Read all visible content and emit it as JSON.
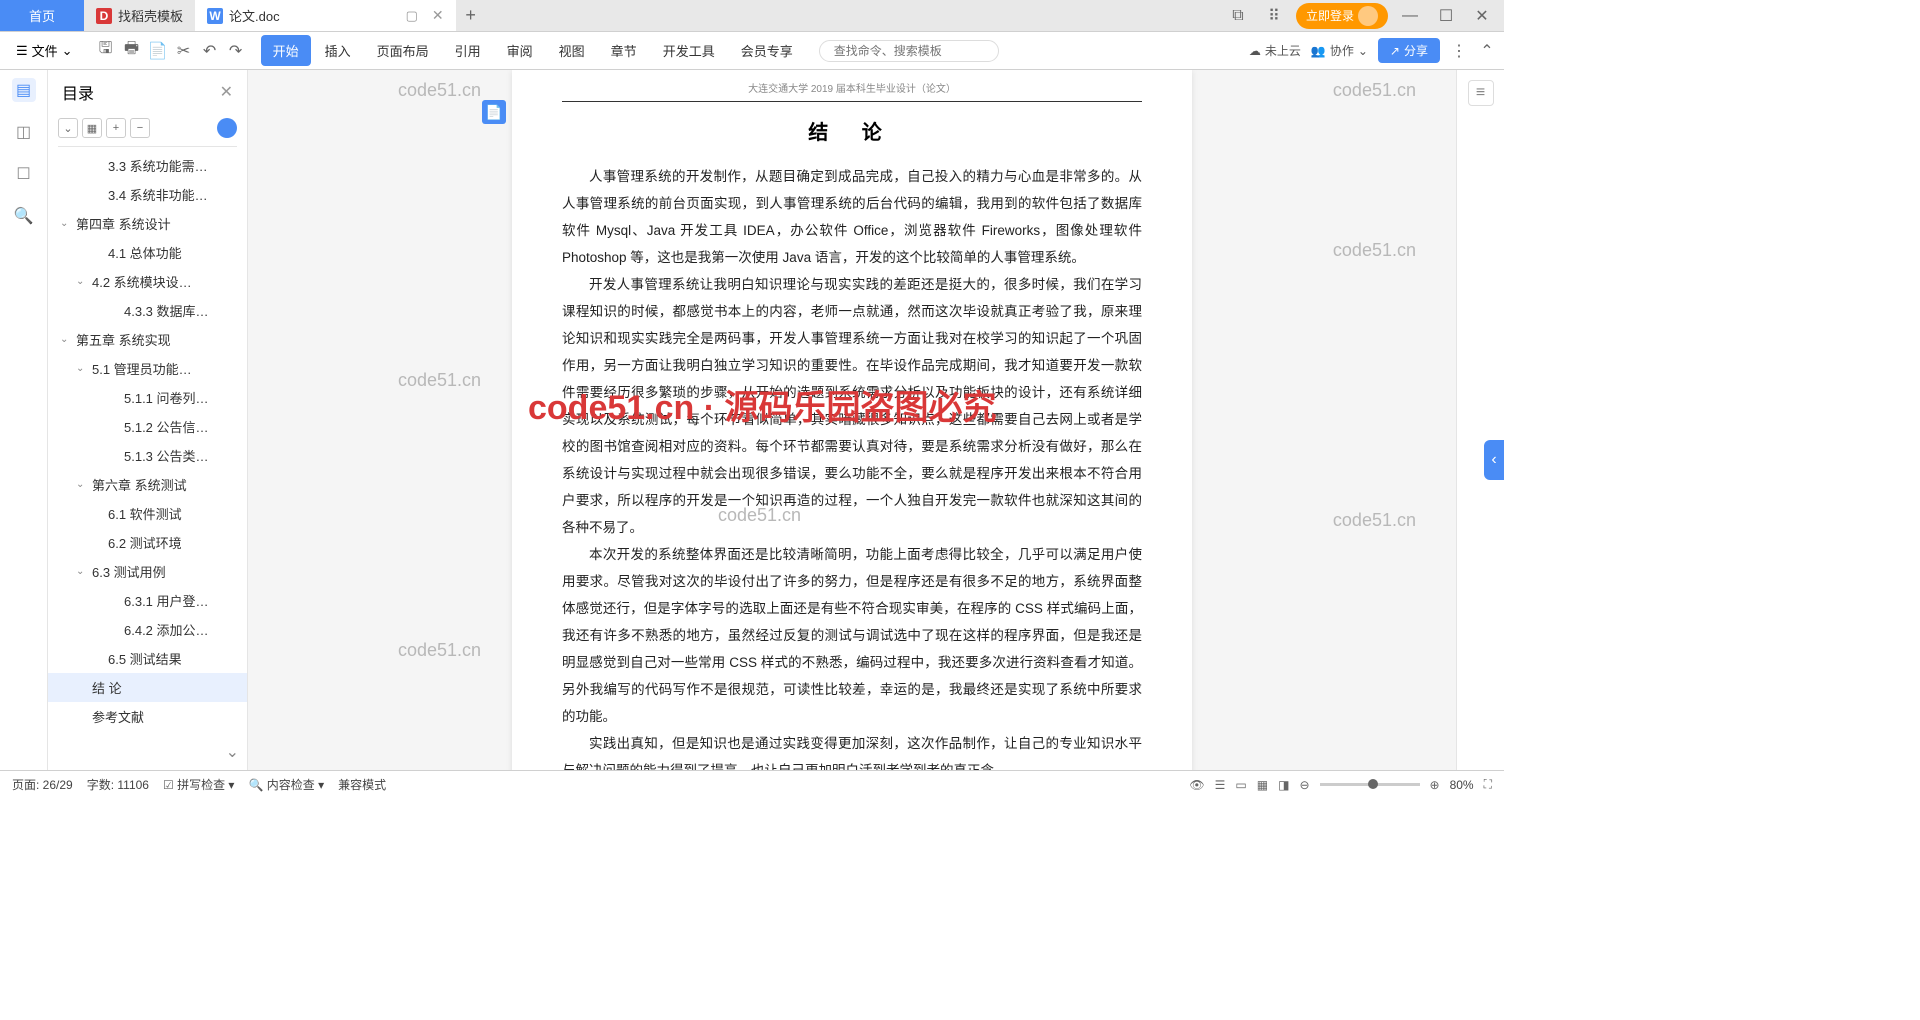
{
  "tabs": {
    "home": "首页",
    "items": [
      {
        "icon": "D",
        "label": "找稻壳模板",
        "active": false
      },
      {
        "icon": "W",
        "label": "论文.doc",
        "active": true
      }
    ],
    "login": "立即登录"
  },
  "ribbon": {
    "file_menu": "文件",
    "tabs": [
      "开始",
      "插入",
      "页面布局",
      "引用",
      "审阅",
      "视图",
      "章节",
      "开发工具",
      "会员专享"
    ],
    "active_idx": 0,
    "search_placeholder": "查找命令、搜索模板",
    "cloud": "未上云",
    "collab": "协作",
    "share": "分享"
  },
  "outline": {
    "title": "目录",
    "items": [
      {
        "indent": 2,
        "chev": "",
        "label": "3.3 系统功能需…"
      },
      {
        "indent": 2,
        "chev": "",
        "label": "3.4 系统非功能…"
      },
      {
        "indent": 0,
        "chev": "⌄",
        "label": "第四章 系统设计"
      },
      {
        "indent": 2,
        "chev": "",
        "label": "4.1 总体功能"
      },
      {
        "indent": 1,
        "chev": "⌄",
        "label": "4.2 系统模块设…"
      },
      {
        "indent": 3,
        "chev": "",
        "label": "4.3.3 数据库…"
      },
      {
        "indent": 0,
        "chev": "⌄",
        "label": "第五章 系统实现"
      },
      {
        "indent": 1,
        "chev": "⌄",
        "label": "5.1 管理员功能…"
      },
      {
        "indent": 3,
        "chev": "",
        "label": "5.1.1 问卷列…"
      },
      {
        "indent": 3,
        "chev": "",
        "label": "5.1.2 公告信…"
      },
      {
        "indent": 3,
        "chev": "",
        "label": "5.1.3 公告类…"
      },
      {
        "indent": 1,
        "chev": "⌄",
        "label": "第六章 系统测试"
      },
      {
        "indent": 2,
        "chev": "",
        "label": "6.1 软件测试"
      },
      {
        "indent": 2,
        "chev": "",
        "label": "6.2 测试环境"
      },
      {
        "indent": 1,
        "chev": "⌄",
        "label": "6.3 测试用例"
      },
      {
        "indent": 3,
        "chev": "",
        "label": "6.3.1 用户登…"
      },
      {
        "indent": 3,
        "chev": "",
        "label": "6.4.2 添加公…"
      },
      {
        "indent": 2,
        "chev": "",
        "label": "6.5 测试结果"
      },
      {
        "indent": 1,
        "chev": "",
        "label": "结  论",
        "selected": true
      },
      {
        "indent": 1,
        "chev": "",
        "label": "参考文献"
      }
    ]
  },
  "doc": {
    "header": "大连交通大学 2019 届本科生毕业设计（论文）",
    "title": "结  论",
    "paras": [
      "人事管理系统的开发制作，从题目确定到成品完成，自己投入的精力与心血是非常多的。从人事管理系统的前台页面实现，到人事管理系统的后台代码的编辑，我用到的软件包括了数据库软件 Mysql、Java 开发工具 IDEA，办公软件 Office，浏览器软件 Fireworks，图像处理软件 Photoshop 等，这也是我第一次使用 Java 语言，开发的这个比较简单的人事管理系统。",
      "开发人事管理系统让我明白知识理论与现实实践的差距还是挺大的，很多时候，我们在学习课程知识的时候，都感觉书本上的内容，老师一点就通，然而这次毕设就真正考验了我，原来理论知识和现实实践完全是两码事，开发人事管理系统一方面让我对在校学习的知识起了一个巩固作用，另一方面让我明白独立学习知识的重要性。在毕设作品完成期间，我才知道要开发一款软件需要经历很多繁琐的步骤，从开始的选题到系统需求分析以及功能板块的设计，还有系统详细实现以及系统测试，每个环节看似简单，其实暗藏很多知识点，这些都需要自己去网上或者是学校的图书馆查阅相对应的资料。每个环节都需要认真对待，要是系统需求分析没有做好，那么在系统设计与实现过程中就会出现很多错误，要么功能不全，要么就是程序开发出来根本不符合用户要求，所以程序的开发是一个知识再造的过程，一个人独自开发完一款软件也就深知这其间的各种不易了。",
      "本次开发的系统整体界面还是比较清晰简明，功能上面考虑得比较全，几乎可以满足用户使用要求。尽管我对这次的毕设付出了许多的努力，但是程序还是有很多不足的地方，系统界面整体感觉还行，但是字体字号的选取上面还是有些不符合现实审美，在程序的 CSS 样式编码上面，我还有许多不熟悉的地方，虽然经过反复的测试与调试选中了现在这样的程序界面，但是我还是明显感觉到自己对一些常用 CSS 样式的不熟悉，编码过程中，我还要多次进行资料查看才知道。另外我编写的代码写作不是很规范，可读性比较差，幸运的是，我最终还是实现了系统中所要求的功能。",
      "实践出真知，但是知识也是通过实践变得更加深刻，这次作品制作，让自己的专业知识水平与解决问题的能力得到了提高。也让自己更加明白活到老学到老的真正含"
    ]
  },
  "watermarks": {
    "gray": "code51.cn",
    "red": "code51.cn · 源码乐园盗图必究"
  },
  "status": {
    "page": "页面: 26/29",
    "words": "字数: 11106",
    "spell": "拼写检查",
    "content": "内容检查",
    "compat": "兼容模式",
    "zoom": "80%"
  }
}
